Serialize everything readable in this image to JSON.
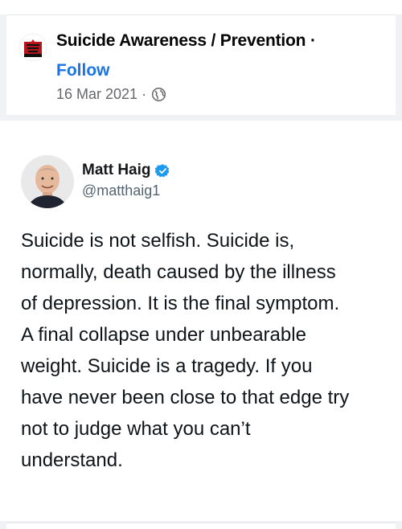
{
  "post_header": {
    "page_name": "Suicide Awareness / Prevention",
    "separator": "·",
    "follow_label": "Follow",
    "date": "16 Mar 2021",
    "audience_icon": "globe-icon"
  },
  "tweet": {
    "author_name": "Matt Haig",
    "verified_icon": "verified-badge-icon",
    "handle": "@matthaig1",
    "text_lines": [
      "Suicide is not selfish. Suicide is,",
      "normally, death caused by the illness",
      "of depression. It is the final symptom.",
      "A final collapse under unbearable",
      "weight. Suicide is a tragedy. If you",
      "have never been close to that edge try",
      "not to judge what you can’t",
      "understand."
    ]
  },
  "colors": {
    "link_blue": "#1b74e4",
    "verified_blue": "#1d9bf0",
    "muted_text": "#65676b",
    "background": "#f0f2f5"
  }
}
